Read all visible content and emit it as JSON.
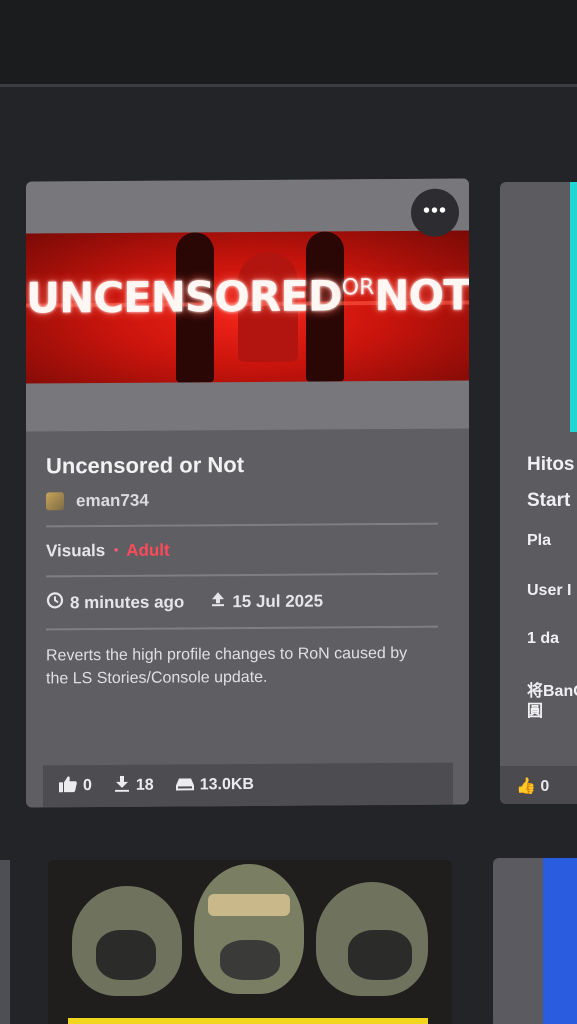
{
  "main_card": {
    "banner_text_left": "UNCENSORED",
    "banner_text_mid": "OR",
    "banner_text_right": "NOT",
    "menu_icon": "more-horizontal-icon",
    "menu_glyph": "•••",
    "title": "Uncensored or Not",
    "author": "eman734",
    "category": "Visuals",
    "tag_separator": "•",
    "tag": "Adult",
    "updated_icon": "clock-icon",
    "updated": "8 minutes ago",
    "uploaded_icon": "upload-icon",
    "uploaded": "15 Jul 2025",
    "description": "Reverts the high profile changes to RoN caused by the LS Stories/Console update.",
    "likes_icon": "thumbs-up-icon",
    "likes": "0",
    "downloads_icon": "download-icon",
    "downloads": "18",
    "size_icon": "drive-icon",
    "size": "13.0KB"
  },
  "right_card": {
    "title_line1": "Hitos",
    "title_line2": "Start",
    "author": "Pla",
    "category": "User I",
    "updated": "1 da",
    "description": "将BanG",
    "description_line2": "圓",
    "likes": "0"
  },
  "colors": {
    "page_bg": "#232427",
    "card_bg": "#5e5e63",
    "adult_tag": "#ff4a5a",
    "accent_cyan": "#21d6d2"
  }
}
